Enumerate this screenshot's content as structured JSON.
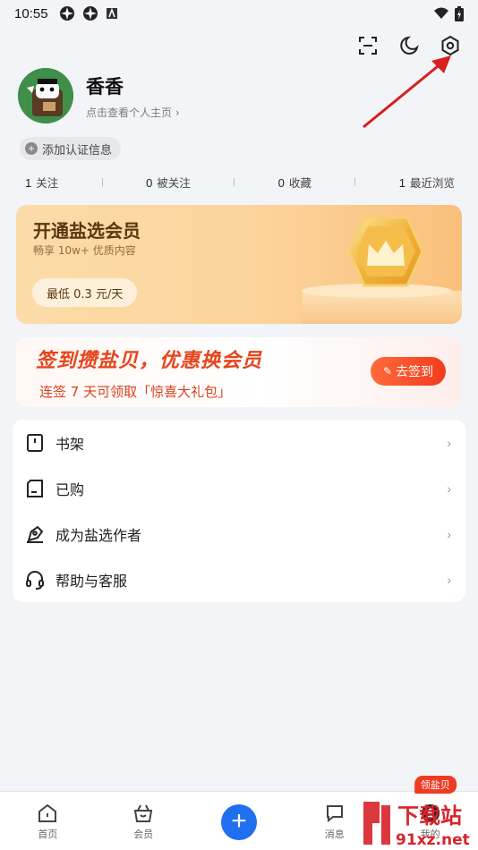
{
  "status_bar": {
    "time": "10:55"
  },
  "top_actions": {
    "scan": "scan-icon",
    "theme": "moon-icon",
    "settings": "settings-icon"
  },
  "profile": {
    "name": "香香",
    "subtitle": "点击查看个人主页 ›"
  },
  "cert_chip": {
    "label": "添加认证信息"
  },
  "stats": [
    {
      "count": "1",
      "label": "关注"
    },
    {
      "count": "0",
      "label": "被关注"
    },
    {
      "count": "0",
      "label": "收藏"
    },
    {
      "count": "1",
      "label": "最近浏览"
    }
  ],
  "vip": {
    "title": "开通盐选会员",
    "subtitle": "畅享 10w+ 优质内容",
    "price": "最低 0.3 元/天"
  },
  "signin": {
    "title": "签到攒盐贝，优惠换会员",
    "subtitle": "连签 7 天可领取「惊喜大礼包」",
    "button": "去签到"
  },
  "menu": [
    {
      "label": "书架",
      "icon": "bookshelf-icon"
    },
    {
      "label": "已购",
      "icon": "purchased-icon"
    },
    {
      "label": "成为盐选作者",
      "icon": "author-pen-icon"
    },
    {
      "label": "帮助与客服",
      "icon": "headset-icon"
    }
  ],
  "bottom_nav": {
    "home": "首页",
    "vip": "会员",
    "messages": "消息",
    "mine": "我的",
    "badge": "领盐贝"
  },
  "watermark": {
    "text": "下载站",
    "domain": "91xz.net"
  },
  "colors": {
    "primary_blue": "#1f6ff0",
    "signin_red": "#e8441b",
    "vip_brown": "#5a3510"
  }
}
